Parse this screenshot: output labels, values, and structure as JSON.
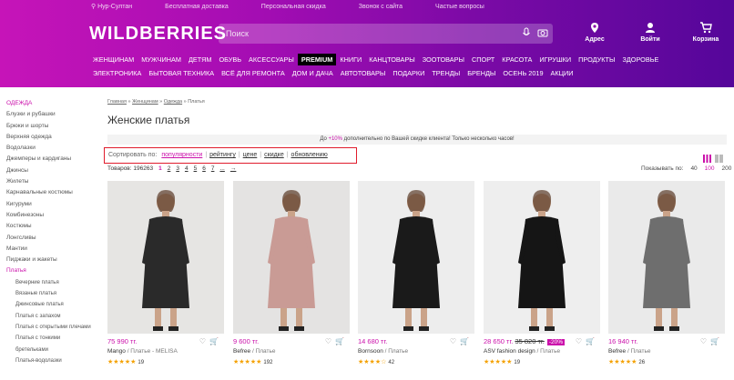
{
  "header": {
    "top_links": [
      "Нур-Султан",
      "Бесплатная доставка",
      "Персональная скидка",
      "Звонок с сайта",
      "Частые вопросы"
    ],
    "logo": "WILDBERRIES",
    "search_placeholder": "Поиск",
    "icons": {
      "address": "Адрес",
      "login": "Войти",
      "cart": "Корзина"
    },
    "gradient": [
      "#c614b8",
      "#55069a"
    ]
  },
  "categories_row1": [
    "ЖЕНЩИНАМ",
    "МУЖЧИНАМ",
    "ДЕТЯМ",
    "ОБУВЬ",
    "АКСЕССУАРЫ",
    "PREMIUM",
    "КНИГИ",
    "КАНЦТОВАРЫ",
    "ЗООТОВАРЫ",
    "СПОРТ",
    "КРАСОТА",
    "ИГРУШКИ",
    "ПРОДУКТЫ",
    "ЗДОРОВЬЕ"
  ],
  "categories_row2": [
    "ЭЛЕКТРОНИКА",
    "БЫТОВАЯ ТЕХНИКА",
    "ВСЁ ДЛЯ РЕМОНТА",
    "ДОМ И ДАЧА",
    "АВТОТОВАРЫ",
    "ПОДАРКИ",
    "ТРЕНДЫ",
    "БРЕНДЫ",
    "ОСЕНЬ 2019",
    "АКЦИИ"
  ],
  "sidebar": [
    {
      "label": "ОДЕЖДА",
      "active": true,
      "sub": false
    },
    {
      "label": "Блузки и рубашки",
      "active": false,
      "sub": false
    },
    {
      "label": "Брюки и шорты",
      "active": false,
      "sub": false
    },
    {
      "label": "Верхняя одежда",
      "active": false,
      "sub": false
    },
    {
      "label": "Водолазки",
      "active": false,
      "sub": false
    },
    {
      "label": "Джемперы и кардиганы",
      "active": false,
      "sub": false
    },
    {
      "label": "Джинсы",
      "active": false,
      "sub": false
    },
    {
      "label": "Жилеты",
      "active": false,
      "sub": false
    },
    {
      "label": "Карнавальные костюмы",
      "active": false,
      "sub": false
    },
    {
      "label": "Кигуруми",
      "active": false,
      "sub": false
    },
    {
      "label": "Комбинезоны",
      "active": false,
      "sub": false
    },
    {
      "label": "Костюмы",
      "active": false,
      "sub": false
    },
    {
      "label": "Лонгсливы",
      "active": false,
      "sub": false
    },
    {
      "label": "Мантии",
      "active": false,
      "sub": false
    },
    {
      "label": "Пиджаки и жакеты",
      "active": false,
      "sub": false
    },
    {
      "label": "Платья",
      "active": true,
      "sub": false
    },
    {
      "label": "Вечерние платья",
      "active": false,
      "sub": true
    },
    {
      "label": "Вязаные платья",
      "active": false,
      "sub": true
    },
    {
      "label": "Джинсовые платья",
      "active": false,
      "sub": true
    },
    {
      "label": "Платья с запахом",
      "active": false,
      "sub": true
    },
    {
      "label": "Платья с открытыми плечами",
      "active": false,
      "sub": true
    },
    {
      "label": "Платья с тонкими",
      "active": false,
      "sub": true
    },
    {
      "label": "бретельками",
      "active": false,
      "sub": true
    },
    {
      "label": "Платья-водолазки",
      "active": false,
      "sub": true
    }
  ],
  "breadcrumb": [
    "Главная",
    "Женщинам",
    "Одежда",
    "Платья"
  ],
  "page_title": "Женские платья",
  "promo": {
    "before": "До ",
    "highlight": "+10%",
    "after": " дополнительно по Вашей скидке клиента! Только несколько часов!"
  },
  "sort": {
    "label": "Сортировать по:",
    "options": [
      "популярности",
      "рейтингу",
      "цене",
      "скидке",
      "обновлению"
    ],
    "active": 0
  },
  "count": {
    "label": "Товаров: 196263",
    "pages": [
      "1",
      "2",
      "3",
      "4",
      "5",
      "6",
      "7",
      "...",
      "→"
    ],
    "current": 0
  },
  "show": {
    "label": "Показывать по:",
    "options": [
      "40",
      "100",
      "200"
    ],
    "active": 1
  },
  "products": [
    {
      "price": "75 990 тг.",
      "old_price": "",
      "discount": "",
      "brand": "Mango",
      "name": "/ Платье - MELISA",
      "rating": 5,
      "reviews": "19",
      "dress_color": "#2a2a2a",
      "bg": "#e6e5e3"
    },
    {
      "price": "9 600 тг.",
      "old_price": "",
      "discount": "",
      "brand": "Befree",
      "name": "/ Платье",
      "rating": 5,
      "reviews": "192",
      "dress_color": "#c99b95",
      "bg": "#e4e3e2"
    },
    {
      "price": "14 680 тг.",
      "old_price": "",
      "discount": "",
      "brand": "Bornsoon",
      "name": "/ Платье",
      "rating": 4,
      "reviews": "42",
      "dress_color": "#1a1a1a",
      "bg": "#ededed"
    },
    {
      "price": "28 650 тг.",
      "old_price": "35 820 тг.",
      "discount": "-20%",
      "brand": "ASV fashion design",
      "name": "/ Платье",
      "rating": 5,
      "reviews": "19",
      "dress_color": "#151515",
      "bg": "#eeeeee"
    },
    {
      "price": "16 940 тг.",
      "old_price": "",
      "discount": "",
      "brand": "Befree",
      "name": "/ Платье",
      "rating": 5,
      "reviews": "26",
      "dress_color": "#6e6e6e",
      "bg": "#eaeaea"
    }
  ]
}
